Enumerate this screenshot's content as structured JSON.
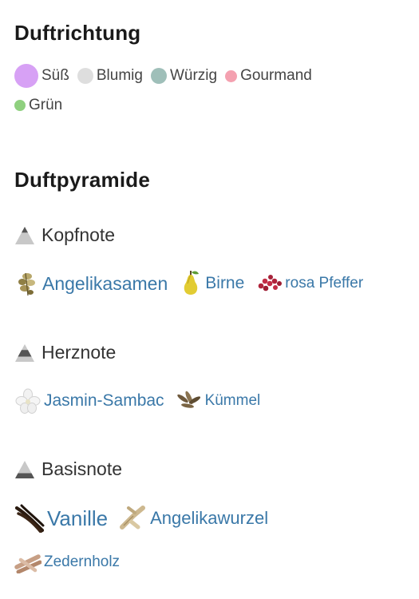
{
  "sections": {
    "scent_direction": {
      "title": "Duftrichtung",
      "legend": [
        {
          "label": "Süß",
          "color": "#d7a1f5"
        },
        {
          "label": "Blumig",
          "color": "#dedede"
        },
        {
          "label": "Würzig",
          "color": "#9fbfb9"
        },
        {
          "label": "Gourmand",
          "color": "#f4a1b0"
        },
        {
          "label": "Grün",
          "color": "#8fd07f"
        }
      ]
    },
    "pyramid": {
      "title": "Duftpyramide",
      "tiers": [
        {
          "label": "Kopfnote",
          "notes": [
            {
              "label": "Angelikasamen",
              "icon": "angelica-seeds-icon"
            },
            {
              "label": "Birne",
              "icon": "pear-icon"
            },
            {
              "label": "rosa Pfeffer",
              "icon": "pink-pepper-icon"
            }
          ]
        },
        {
          "label": "Herznote",
          "notes": [
            {
              "label": "Jasmin-Sambac",
              "icon": "jasmine-flower-icon"
            },
            {
              "label": "Kümmel",
              "icon": "caraway-icon"
            }
          ]
        },
        {
          "label": "Basisnote",
          "notes": [
            {
              "label": "Vanille",
              "icon": "vanilla-pod-icon"
            },
            {
              "label": "Angelikawurzel",
              "icon": "angelica-root-icon"
            },
            {
              "label": "Zedernholz",
              "icon": "cedarwood-icon"
            }
          ]
        }
      ]
    }
  }
}
